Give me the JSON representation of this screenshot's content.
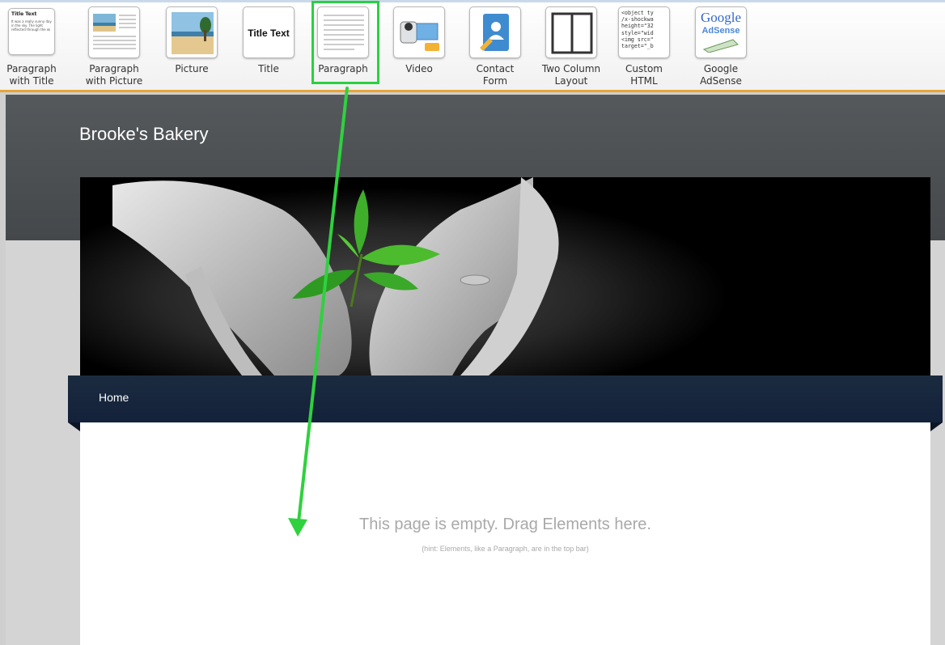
{
  "toolbar": {
    "items": [
      {
        "label": "Paragraph\nwith Title",
        "thumb_title": "Title Text",
        "thumb_text": "It was a really sunny day in the sky. The light reflected through the wi"
      },
      {
        "label": "Paragraph\nwith Picture"
      },
      {
        "label": "Picture"
      },
      {
        "label": "Title",
        "thumb_title": "Title Text"
      },
      {
        "label": "Paragraph"
      },
      {
        "label": "Video"
      },
      {
        "label": "Contact\nForm"
      },
      {
        "label": "Two Column\nLayout"
      },
      {
        "label": "Custom\nHTML",
        "thumb_code": "<object ty\n/x-shockwa\nheight=\"32\nstyle=\"wid\n<img src=\"\ntarget=\"_b"
      },
      {
        "label": "Google\nAdSense",
        "thumb_brand": "Google",
        "thumb_sub": "AdSense"
      }
    ],
    "selected": "Paragraph"
  },
  "site": {
    "title": "Brooke's Bakery",
    "nav": [
      "Home"
    ],
    "empty_message": "This page is empty. Drag Elements here.",
    "hint": "(hint: Elements, like a Paragraph, are in the top bar)"
  },
  "colors": {
    "toolbar_accent": "#e8a437",
    "selection_green": "#29d13f",
    "header_bg": "#4f5356",
    "nav_bg": "#16263c"
  },
  "icons": [
    "paragraph-with-title",
    "paragraph-with-picture",
    "picture",
    "title",
    "paragraph",
    "video-camera",
    "contact-form",
    "two-column-layout",
    "custom-html",
    "google-adsense"
  ]
}
